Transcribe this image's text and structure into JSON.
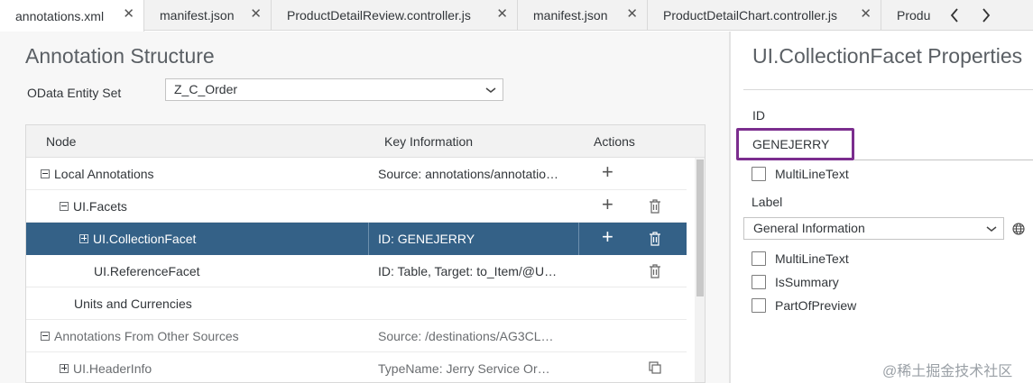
{
  "tabs": [
    {
      "label": "annotations.xml",
      "active": true
    },
    {
      "label": "manifest.json"
    },
    {
      "label": "ProductDetailReview.controller.js"
    },
    {
      "label": "manifest.json"
    },
    {
      "label": "ProductDetailChart.controller.js"
    },
    {
      "label": "Produ"
    }
  ],
  "left": {
    "title": "Annotation Structure",
    "entity_label": "OData Entity Set",
    "entity_value": "Z_C_Order",
    "columns": {
      "node": "Node",
      "key": "Key Information",
      "actions": "Actions"
    },
    "rows": [
      {
        "node": "Local Annotations",
        "key": "Source: annotations/annotatio…"
      },
      {
        "node": "UI.Facets",
        "key": ""
      },
      {
        "node": "UI.CollectionFacet",
        "key": "ID: GENEJERRY"
      },
      {
        "node": "UI.ReferenceFacet",
        "key": "ID: Table, Target: to_Item/@U…"
      },
      {
        "node": "Units and Currencies",
        "key": ""
      },
      {
        "node": "Annotations From Other Sources",
        "key": "Source: /destinations/AG3CL…"
      },
      {
        "node": "UI.HeaderInfo",
        "key": "TypeName: Jerry Service Or…"
      }
    ]
  },
  "right": {
    "title": "UI.CollectionFacet Properties",
    "id_label": "ID",
    "id_value": "GENEJERRY",
    "multiline_1": "MultiLineText",
    "label_label": "Label",
    "label_value": "General Information",
    "multiline_2": "MultiLineText",
    "is_summary": "IsSummary",
    "part_of_preview": "PartOfPreview"
  },
  "watermark": "@稀土掘金技术社区",
  "colors": {
    "selected_row": "#346187",
    "highlight_border": "#7b2d8e"
  }
}
